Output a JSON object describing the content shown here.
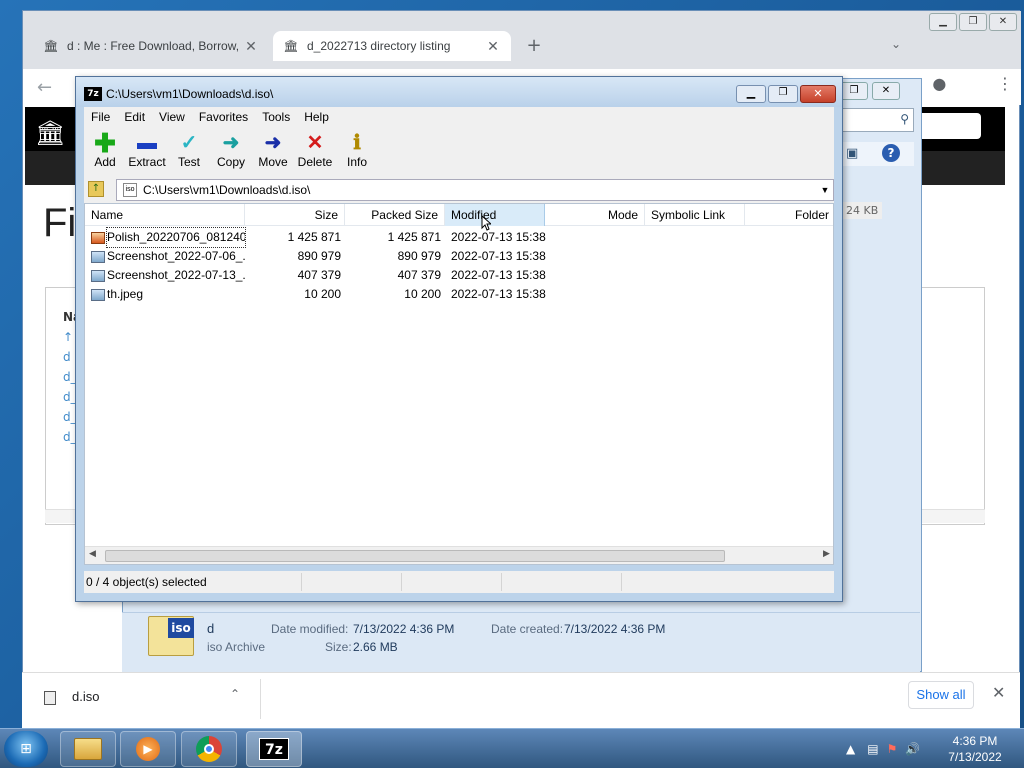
{
  "browser": {
    "tabs": [
      {
        "title": "d : Me : Free Download, Borrow,",
        "icon": "archive-icon"
      },
      {
        "title": "d_2022713 directory listing",
        "icon": "archive-icon"
      }
    ]
  },
  "background_page": {
    "title": "Fi",
    "links": [
      "Na",
      "↑",
      "d",
      "d_",
      "d_",
      "d_",
      "d_"
    ],
    "size_badge": "24 KB"
  },
  "explorer_details": {
    "name": "d",
    "type": "iso Archive",
    "date_modified_label": "Date modified:",
    "date_modified": "7/13/2022 4:36 PM",
    "date_created_label": "Date created:",
    "date_created": "7/13/2022 4:36 PM",
    "size_label": "Size:",
    "size": "2.66 MB",
    "icon_label": "iso"
  },
  "sevenzip": {
    "title": "C:\\Users\\vm1\\Downloads\\d.iso\\",
    "icon_text": "7z",
    "menu": [
      "File",
      "Edit",
      "View",
      "Favorites",
      "Tools",
      "Help"
    ],
    "toolbar": [
      {
        "label": "Add",
        "glyph": "+",
        "color": "#18a818"
      },
      {
        "label": "Extract",
        "glyph": "▬",
        "color": "#1a3fc2"
      },
      {
        "label": "Test",
        "glyph": "✓",
        "color": "#2bb5c4"
      },
      {
        "label": "Copy",
        "glyph": "➜",
        "color": "#1aa0a0"
      },
      {
        "label": "Move",
        "glyph": "➜",
        "color": "#1a2fa8"
      },
      {
        "label": "Delete",
        "glyph": "✕",
        "color": "#d41c1c"
      },
      {
        "label": "Info",
        "glyph": "i",
        "color": "#b08a00"
      }
    ],
    "address": "C:\\Users\\vm1\\Downloads\\d.iso\\",
    "columns": [
      "Name",
      "Size",
      "Packed Size",
      "Modified",
      "Mode",
      "Symbolic Link",
      "Folder"
    ],
    "files": [
      {
        "name": "Polish_20220706_081240...",
        "size": "1 425 871",
        "packed": "1 425 871",
        "modified": "2022-07-13 15:38",
        "icon": "pdf"
      },
      {
        "name": "Screenshot_2022-07-06_...",
        "size": "890 979",
        "packed": "890 979",
        "modified": "2022-07-13 15:38",
        "icon": "image"
      },
      {
        "name": "Screenshot_2022-07-13_...",
        "size": "407 379",
        "packed": "407 379",
        "modified": "2022-07-13 15:38",
        "icon": "image"
      },
      {
        "name": "th.jpeg",
        "size": "10 200",
        "packed": "10 200",
        "modified": "2022-07-13 15:38",
        "icon": "image"
      }
    ],
    "status": "0 / 4 object(s) selected"
  },
  "downloads": {
    "file": "d.iso",
    "show_all": "Show all"
  },
  "taskbar": {
    "apps": [
      "explorer",
      "media-player",
      "chrome",
      "7-zip"
    ],
    "time": "4:36 PM",
    "date": "7/13/2022"
  }
}
